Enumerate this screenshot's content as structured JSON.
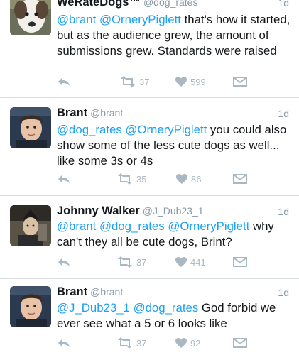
{
  "tweets": [
    {
      "name": "WeRateDogs™",
      "handle": "@dog_rates",
      "time": "1d",
      "parts": [
        "@brant",
        " ",
        "@OrneryPiglett",
        " that's how it started, but as the audience grew, the amount of submissions grew. Standards were raised"
      ],
      "retweets": "37",
      "likes": "599"
    },
    {
      "name": "Brant",
      "handle": "@brant",
      "time": "1d",
      "parts": [
        "@dog_rates",
        " ",
        "@OrneryPiglett",
        " you could also show some of the less cute dogs as well... like some 3s or 4s"
      ],
      "retweets": "35",
      "likes": "86"
    },
    {
      "name": "Johnny Walker",
      "handle": "@J_Dub23_1",
      "time": "1d",
      "parts": [
        "@brant",
        " ",
        "@dog_rates",
        " ",
        "@OrneryPiglett",
        " why can't they all be cute dogs, Brint?"
      ],
      "retweets": "37",
      "likes": "441"
    },
    {
      "name": "Brant",
      "handle": "@brant",
      "time": "1d",
      "parts": [
        "@J_Dub23_1",
        " ",
        "@dog_rates",
        " God forbid we ever see what a 5 or 6 looks like"
      ],
      "retweets": "37",
      "likes": "92"
    }
  ],
  "icons": {
    "reply": "reply-icon",
    "retweet": "retweet-icon",
    "like": "heart-icon",
    "dm": "direct-message-icon"
  },
  "colors": {
    "mention": "#1da1f2",
    "meta": "#8899a6",
    "action": "#aab8c2",
    "divider": "#d6dbe0"
  }
}
